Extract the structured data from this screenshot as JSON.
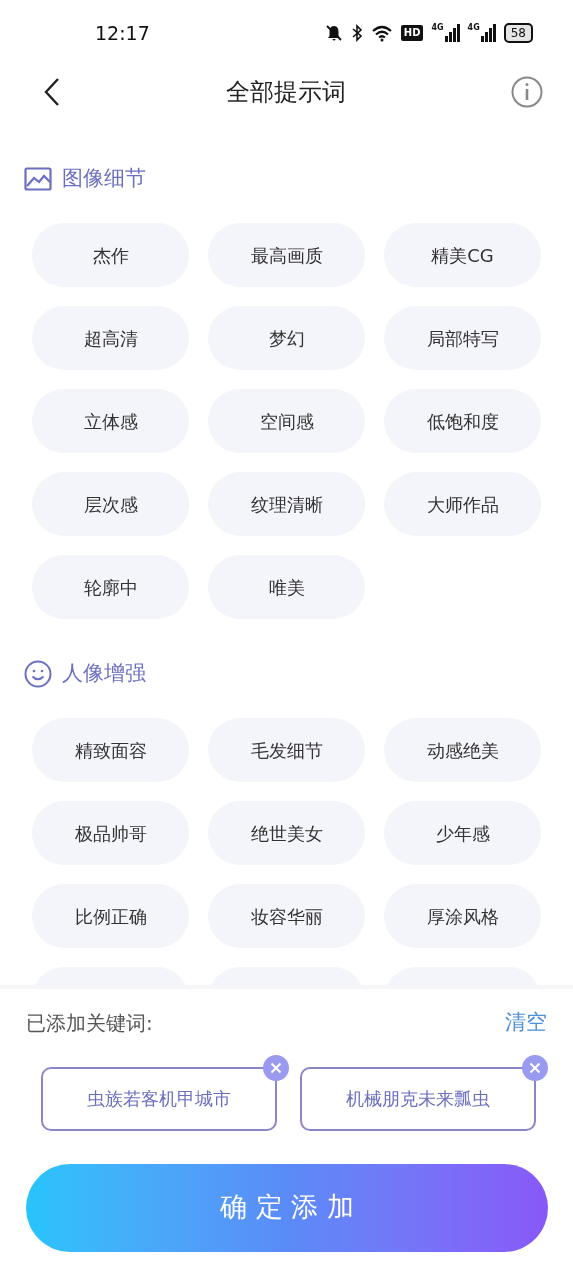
{
  "status_bar": {
    "time": "12:17",
    "hd": "HD",
    "networks": [
      "4G",
      "4G"
    ],
    "battery": "58"
  },
  "header": {
    "title": "全部提示词"
  },
  "sections": [
    {
      "kind": "image",
      "title": "图像细节",
      "tags": [
        "杰作",
        "最高画质",
        "精美CG",
        "超高清",
        "梦幻",
        "局部特写",
        "立体感",
        "空间感",
        "低饱和度",
        "层次感",
        "纹理清晰",
        "大师作品",
        "轮廓中",
        "唯美"
      ]
    },
    {
      "kind": "smile",
      "title": "人像增强",
      "tags": [
        "精致面容",
        "毛发细节",
        "动感绝美",
        "极品帅哥",
        "绝世美女",
        "少年感",
        "比例正确",
        "妆容华丽",
        "厚涂风格"
      ]
    }
  ],
  "added": {
    "label": "已添加关键词:",
    "clear": "清空",
    "keywords": [
      "虫族若客机甲城市",
      "机械朋克未来瓢虫"
    ]
  },
  "confirm": "确 定 添 加"
}
